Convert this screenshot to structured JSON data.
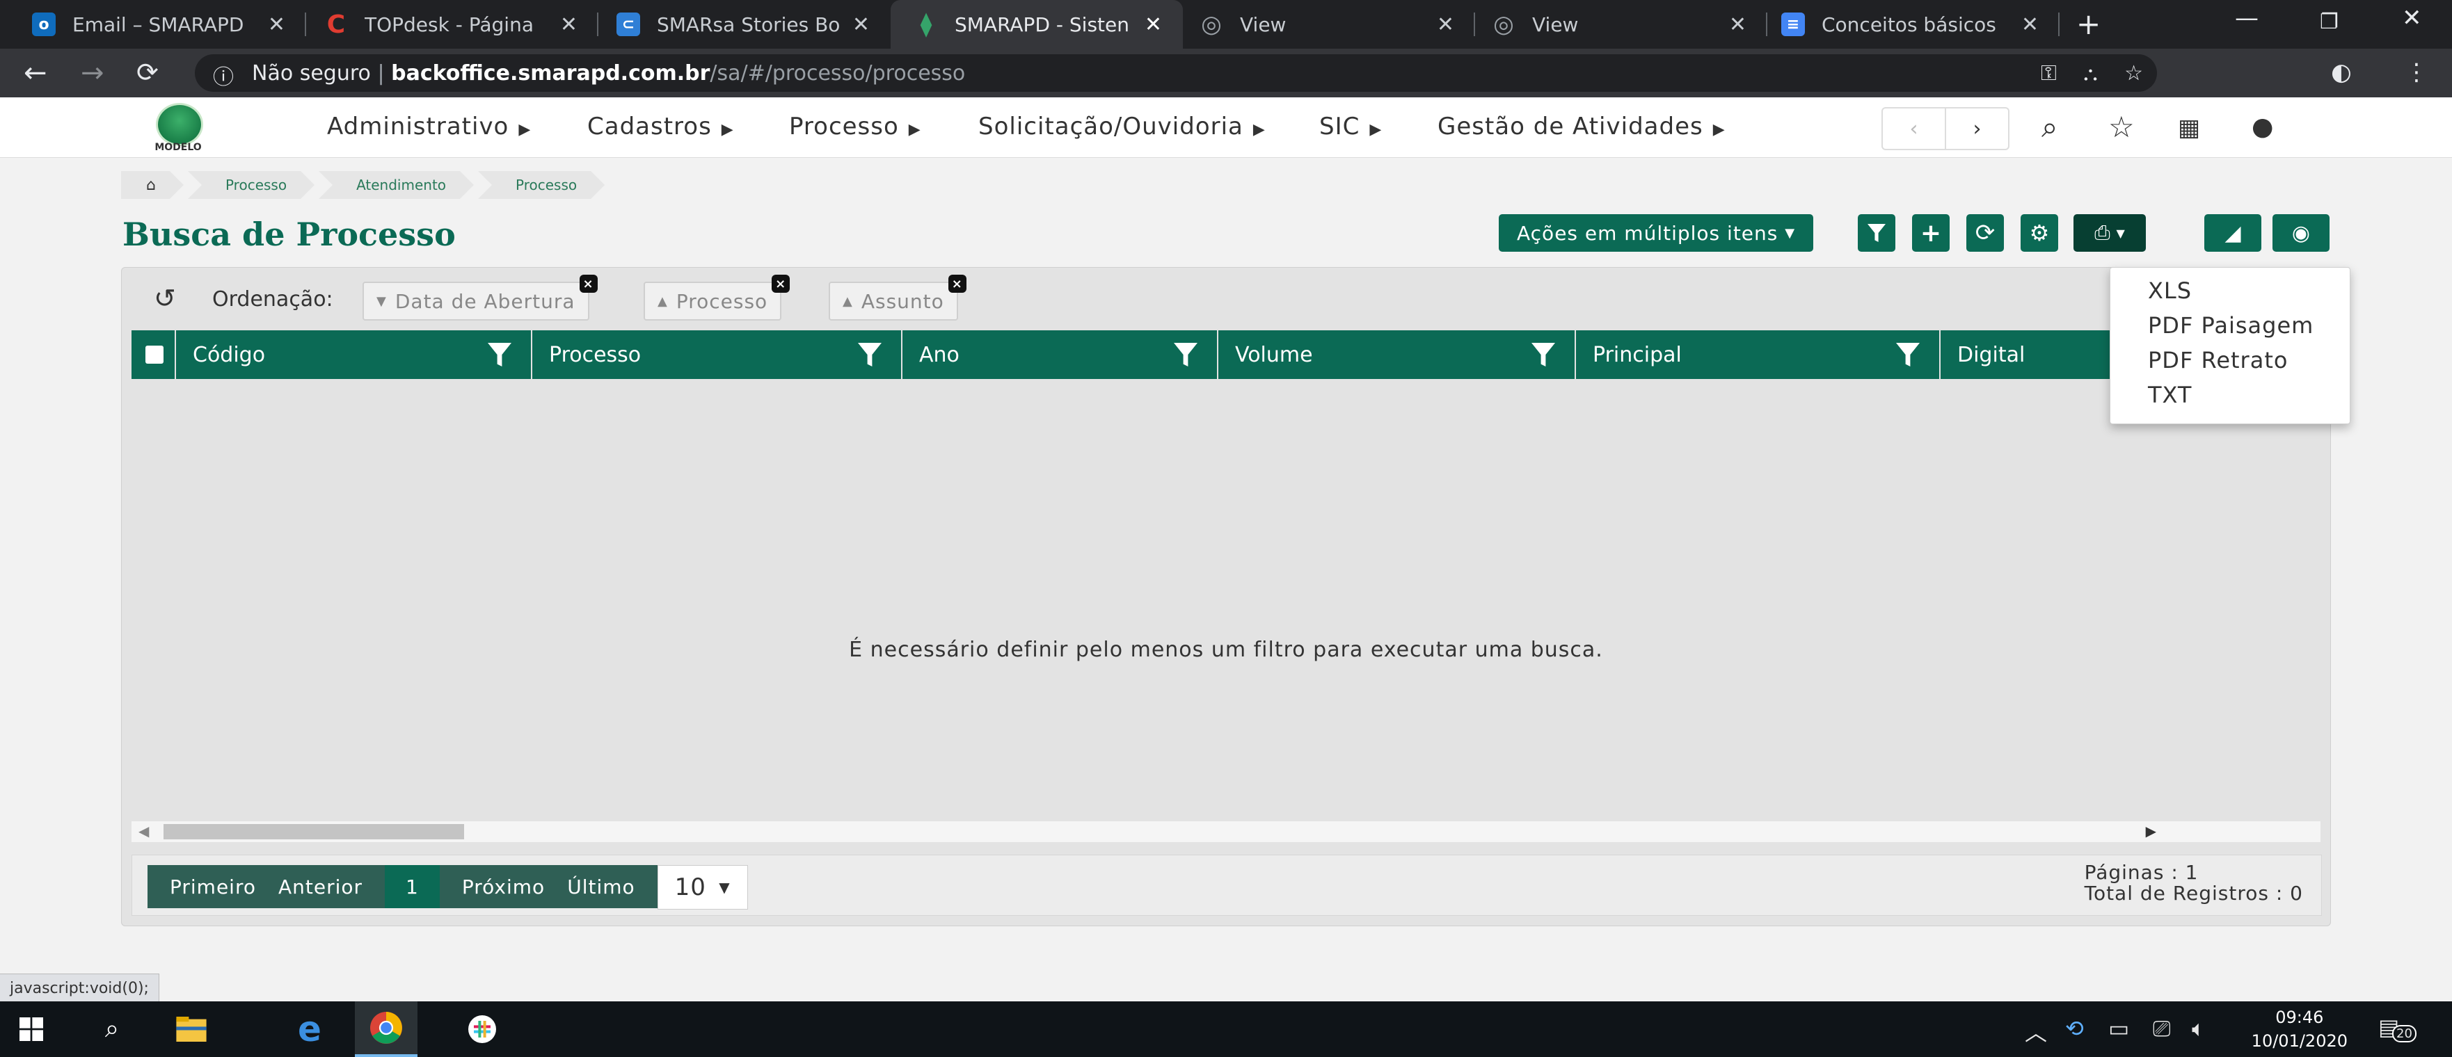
{
  "browser": {
    "tabs": [
      {
        "title": "Email – SMARAPD",
        "icon": "outlook-icon",
        "color": "#0f6cbd",
        "glyph": "o"
      },
      {
        "title": "TOPdesk - Página",
        "icon": "topdesk-icon",
        "color": "#e03c31",
        "glyph": "C"
      },
      {
        "title": "SMARsa Stories Bo",
        "icon": "azure-devops-icon",
        "color": "#2f7fd6",
        "glyph": "⊂"
      },
      {
        "title": "SMARAPD - Sisten",
        "icon": "smarapd-icon",
        "color": "#35a46a",
        "glyph": "⧫"
      },
      {
        "title": "View",
        "icon": "globe-icon",
        "color": "#5f6368",
        "glyph": "◎"
      },
      {
        "title": "View",
        "icon": "globe-icon",
        "color": "#5f6368",
        "glyph": "◎"
      },
      {
        "title": "Conceitos básicos",
        "icon": "docs-icon",
        "color": "#4285f4",
        "glyph": "≡"
      }
    ],
    "url_security": "Não seguro",
    "url_host": "backoffice.smarapd.com.br",
    "url_path": "/sa/#/processo/processo"
  },
  "header": {
    "logo_text": "MODELO",
    "menu": [
      "Administrativo",
      "Cadastros",
      "Processo",
      "Solicitação/Ouvidoria",
      "SIC",
      "Gestão de Atividades"
    ]
  },
  "breadcrumb": [
    "Processo",
    "Atendimento",
    "Processo"
  ],
  "page": {
    "title": "Busca de Processo",
    "bulk_actions_label": "Ações em múltiplos itens"
  },
  "sort": {
    "label": "Ordenação:",
    "chips": [
      "Data de Abertura",
      "Processo",
      "Assunto"
    ]
  },
  "table": {
    "columns": [
      "Código",
      "Processo",
      "Ano",
      "Volume",
      "Principal",
      "Digital"
    ],
    "empty_message": "É necessário definir pelo menos um filtro para executar uma busca."
  },
  "pagination": {
    "first": "Primeiro",
    "previous": "Anterior",
    "current": "1",
    "next": "Próximo",
    "last": "Último",
    "page_size": "10",
    "pages_text": "Páginas : 1",
    "total_text": "Total de Registros : 0"
  },
  "print_menu": [
    "XLS",
    "PDF Paisagem",
    "PDF Retrato",
    "TXT"
  ],
  "status_bar": "javascript:void(0);",
  "taskbar": {
    "time": "09:46",
    "date": "10/01/2020",
    "notifications": "20"
  },
  "colors": {
    "primary": "#0b6a55",
    "pager_dark": "#2f5f55"
  }
}
